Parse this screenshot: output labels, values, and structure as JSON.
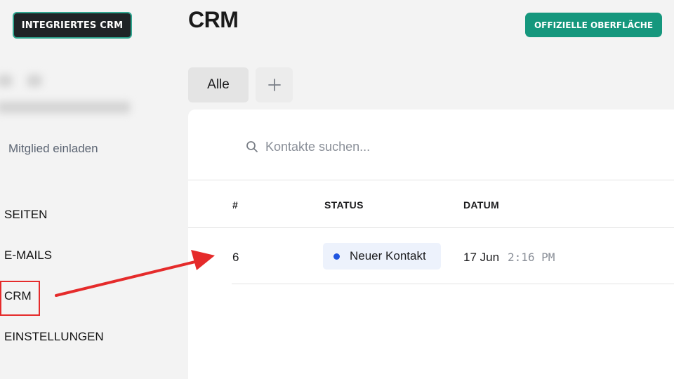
{
  "header": {
    "badge_label": "INTEGRIERTES CRM",
    "title": "CRM",
    "official_button_label": "OFFIZIELLE OBERFLÄCHE"
  },
  "sidebar": {
    "invite_label": "Mitglied einladen",
    "items": [
      {
        "label": "SEITEN"
      },
      {
        "label": "E-MAILS"
      },
      {
        "label": "CRM",
        "highlighted": true
      },
      {
        "label": "EINSTELLUNGEN"
      }
    ]
  },
  "tabs": [
    {
      "label": "Alle",
      "active": true
    }
  ],
  "search": {
    "placeholder": "Kontakte suchen...",
    "icon": "search-icon"
  },
  "table": {
    "columns": [
      "#",
      "STATUS",
      "DATUM"
    ],
    "rows": [
      {
        "id": "6",
        "status": "Neuer Kontakt",
        "date": "17 Jun",
        "time": "2:16 PM"
      }
    ]
  },
  "colors": {
    "badge_border": "#2fa58f",
    "official_button": "#15977d",
    "status_dot": "#1f55e0",
    "annotation": "#e52b2b"
  }
}
